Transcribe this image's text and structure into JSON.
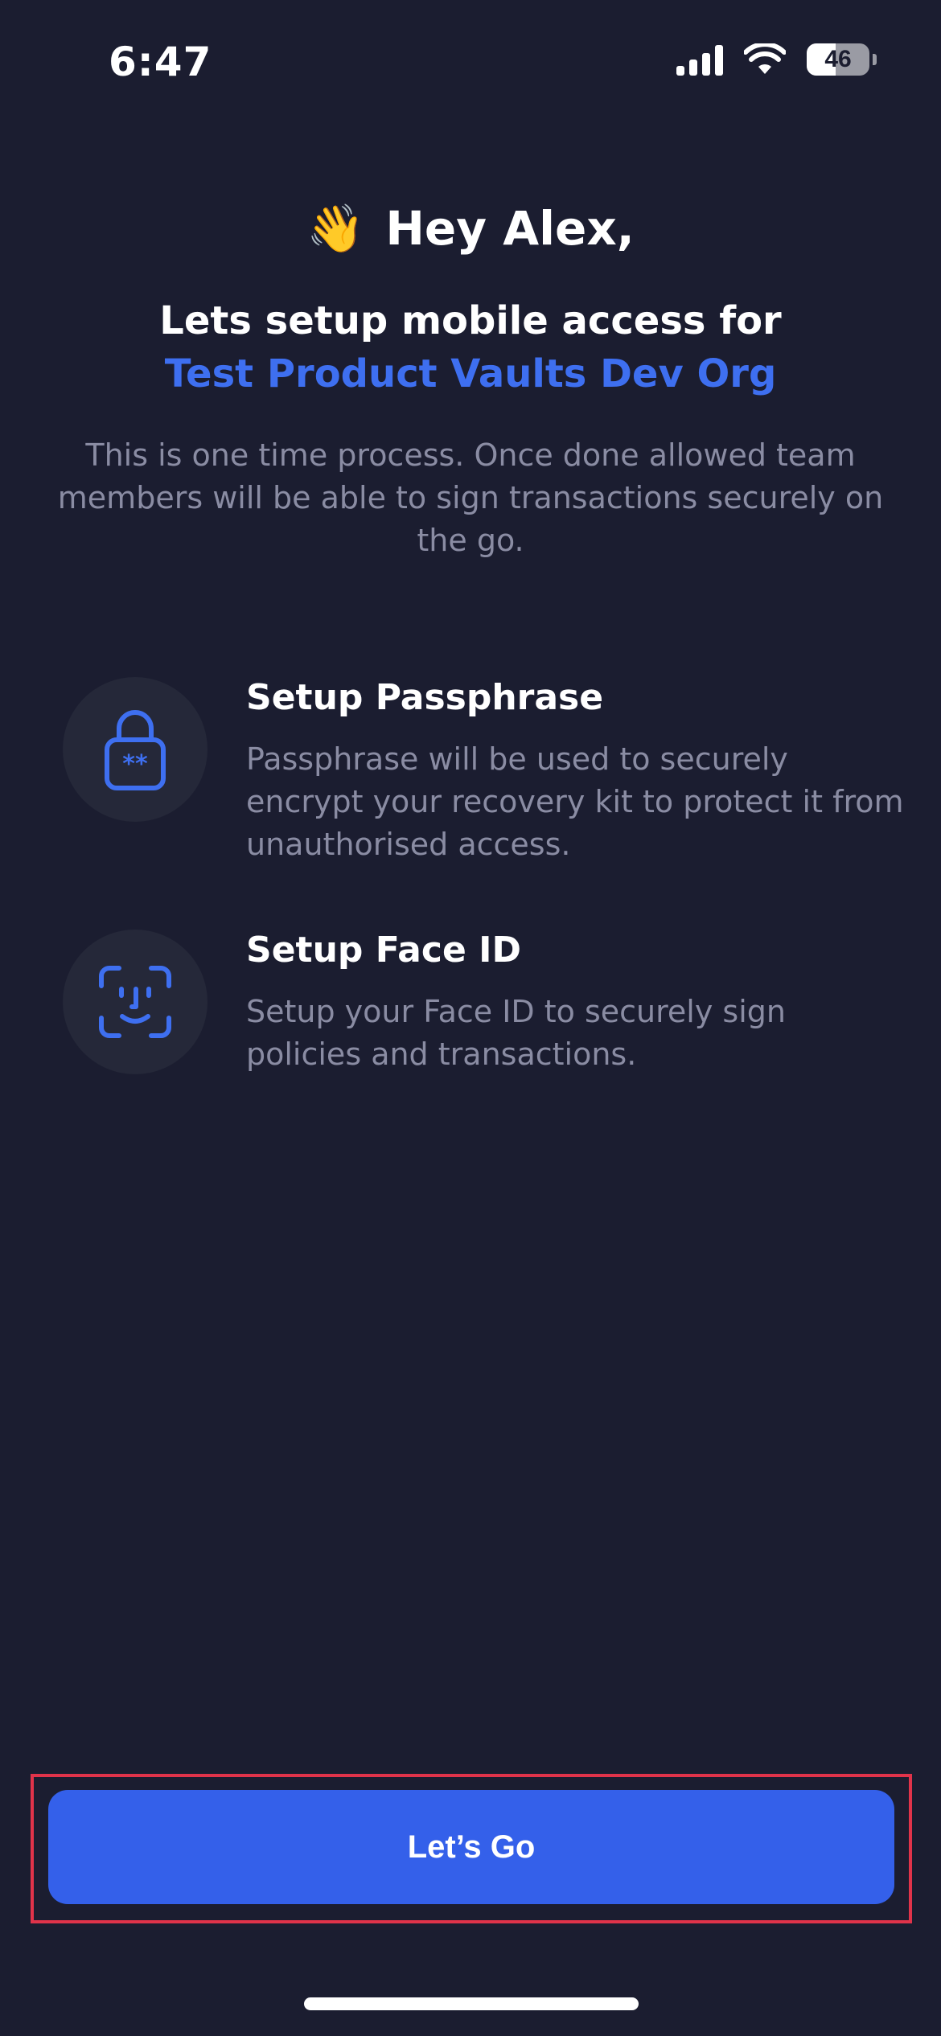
{
  "status_bar": {
    "time": "6:47",
    "battery_level": "46",
    "battery_fraction": 0.46,
    "icons": [
      "cellular-signal-icon",
      "wifi-icon",
      "battery-icon"
    ]
  },
  "greeting": {
    "emoji": "👋",
    "text": "Hey Alex,"
  },
  "heading": "Lets setup mobile access for",
  "org_name": "Test Product Vaults Dev Org",
  "intro": "This is one time process. Once done allowed team members will be able to sign transactions securely on the go.",
  "features": [
    {
      "icon": "lock-icon",
      "title": "Setup Passphrase",
      "description": "Passphrase will be used to securely encrypt your recovery kit to protect it from unauthorised access."
    },
    {
      "icon": "face-id-icon",
      "title": "Setup Face ID",
      "description": "Setup your Face ID to securely sign policies and transactions."
    }
  ],
  "cta": {
    "label": "Let’s Go"
  },
  "colors": {
    "background": "#1b1d30",
    "accent": "#3e6ff0",
    "button": "#3460ea",
    "muted_text": "#8a8ca3",
    "highlight_frame": "#e0334a"
  }
}
